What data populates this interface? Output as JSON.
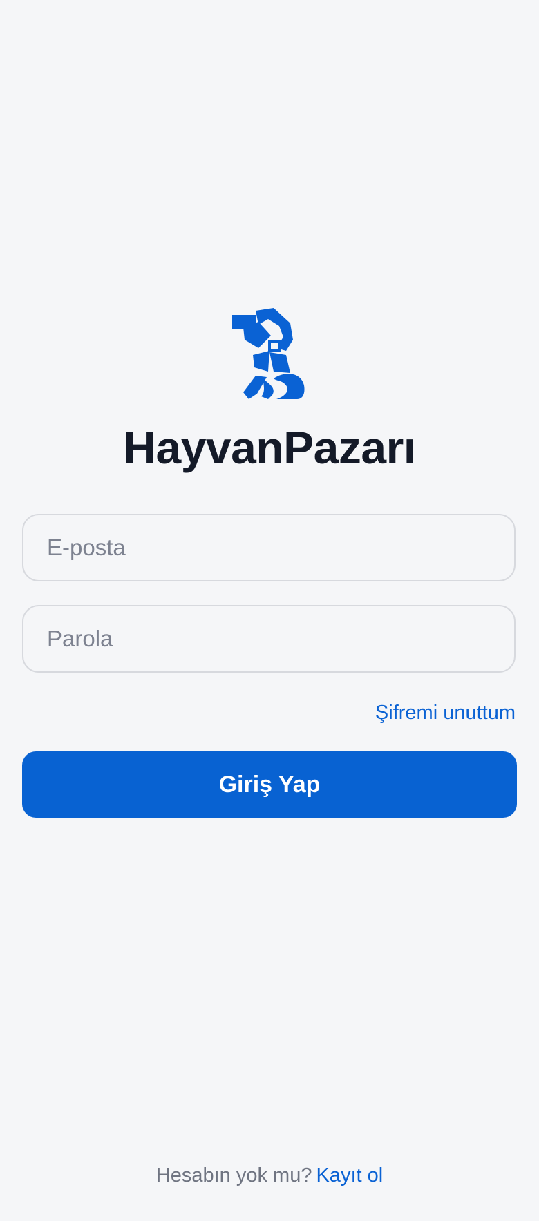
{
  "app": {
    "title": "HayvanPazarı",
    "logo_icon": "abstract-dog-logo-icon",
    "accent_color": "#0862d2"
  },
  "login_form": {
    "email_placeholder": "E-posta",
    "email_value": "",
    "password_placeholder": "Parola",
    "password_value": "",
    "forgot_password_label": "Şifremi unuttum",
    "submit_label": "Giriş Yap"
  },
  "footer": {
    "question": "Hesabın yok mu?",
    "register_label": "Kayıt ol"
  }
}
